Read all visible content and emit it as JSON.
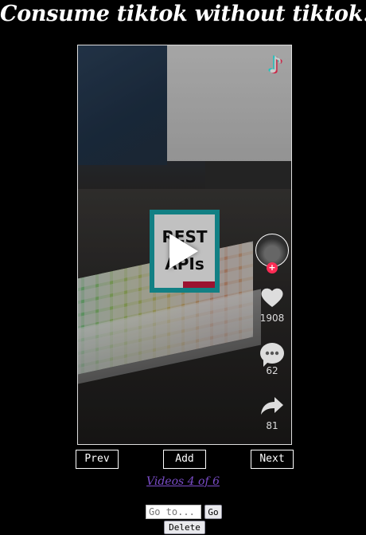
{
  "header": {
    "title": "Consume tiktok without tiktok."
  },
  "video": {
    "logo_glyph": "♪",
    "thumbnail_line1": "REST",
    "thumbnail_line2": "APIs",
    "avatar_plus": "+",
    "likes": "1908",
    "comments": "62",
    "shares": "81",
    "colors": {
      "tiktok_cyan": "#25f4ee",
      "tiktok_red": "#fe2c55",
      "thumb_teal": "#17a0a6"
    }
  },
  "nav": {
    "prev_label": "Prev",
    "add_label": "Add",
    "next_label": "Next"
  },
  "counter": {
    "text": "Videos 4 of 6"
  },
  "goto": {
    "placeholder": "Go to...",
    "go_label": "Go"
  },
  "delete_label": "Delete"
}
